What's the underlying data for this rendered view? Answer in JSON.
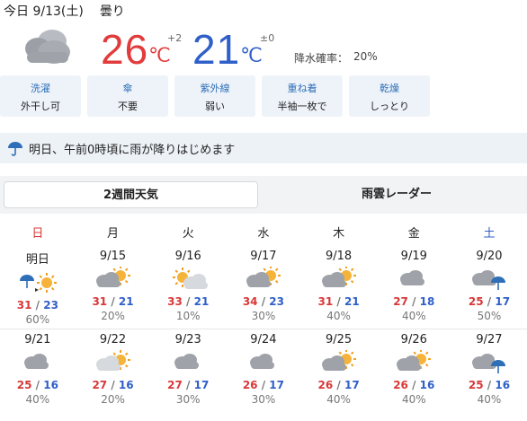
{
  "header": {
    "date": "今日 9/13(土)",
    "condition": "曇り"
  },
  "today": {
    "high": "26",
    "high_unit": "℃",
    "high_diff": "+2",
    "low": "21",
    "low_unit": "℃",
    "low_diff": "±0",
    "precip_label": "降水確率：",
    "precip_value": "20%",
    "icon": "cloud-icon"
  },
  "indices": [
    {
      "title": "洗濯",
      "value": "外干し可"
    },
    {
      "title": "傘",
      "value": "不要"
    },
    {
      "title": "紫外線",
      "value": "弱い"
    },
    {
      "title": "重ね着",
      "value": "半袖一枚で"
    },
    {
      "title": "乾燥",
      "value": "しっとり"
    }
  ],
  "alert": {
    "text": "明日、午前0時頃に雨が降りはじめます",
    "icon": "umbrella-icon"
  },
  "tabs": [
    {
      "label": "2週間天気"
    },
    {
      "label": "雨雲レーダー"
    }
  ],
  "weekdays": [
    {
      "label": "日",
      "color": "#d93838"
    },
    {
      "label": "月",
      "color": "#222222"
    },
    {
      "label": "火",
      "color": "#222222"
    },
    {
      "label": "水",
      "color": "#222222"
    },
    {
      "label": "木",
      "color": "#222222"
    },
    {
      "label": "金",
      "color": "#222222"
    },
    {
      "label": "土",
      "color": "#2f5fc8"
    }
  ],
  "forecast": [
    {
      "date": "明日",
      "icon": "rain-then-sun-icon",
      "high": "31",
      "low": "23",
      "pct": "60%"
    },
    {
      "date": "9/15",
      "icon": "cloud-sun-icon",
      "high": "31",
      "low": "21",
      "pct": "20%"
    },
    {
      "date": "9/16",
      "icon": "sun-cloud-icon",
      "high": "33",
      "low": "21",
      "pct": "10%"
    },
    {
      "date": "9/17",
      "icon": "cloud-sun-icon",
      "high": "34",
      "low": "23",
      "pct": "30%"
    },
    {
      "date": "9/18",
      "icon": "cloud-sun-icon",
      "high": "31",
      "low": "21",
      "pct": "40%"
    },
    {
      "date": "9/19",
      "icon": "cloud-icon",
      "high": "27",
      "low": "18",
      "pct": "40%"
    },
    {
      "date": "9/20",
      "icon": "cloud-rain-icon",
      "high": "25",
      "low": "17",
      "pct": "50%"
    },
    {
      "date": "9/21",
      "icon": "cloud-icon",
      "high": "25",
      "low": "16",
      "pct": "40%"
    },
    {
      "date": "9/22",
      "icon": "light-cloud-sun-icon",
      "high": "27",
      "low": "16",
      "pct": "20%"
    },
    {
      "date": "9/23",
      "icon": "cloud-icon",
      "high": "27",
      "low": "17",
      "pct": "30%"
    },
    {
      "date": "9/24",
      "icon": "cloud-icon",
      "high": "26",
      "low": "17",
      "pct": "30%"
    },
    {
      "date": "9/25",
      "icon": "cloud-sun-icon",
      "high": "26",
      "low": "17",
      "pct": "40%"
    },
    {
      "date": "9/26",
      "icon": "cloud-sun-icon",
      "high": "26",
      "low": "16",
      "pct": "40%"
    },
    {
      "date": "9/27",
      "icon": "cloud-rain-icon",
      "high": "25",
      "low": "16",
      "pct": "40%"
    }
  ]
}
